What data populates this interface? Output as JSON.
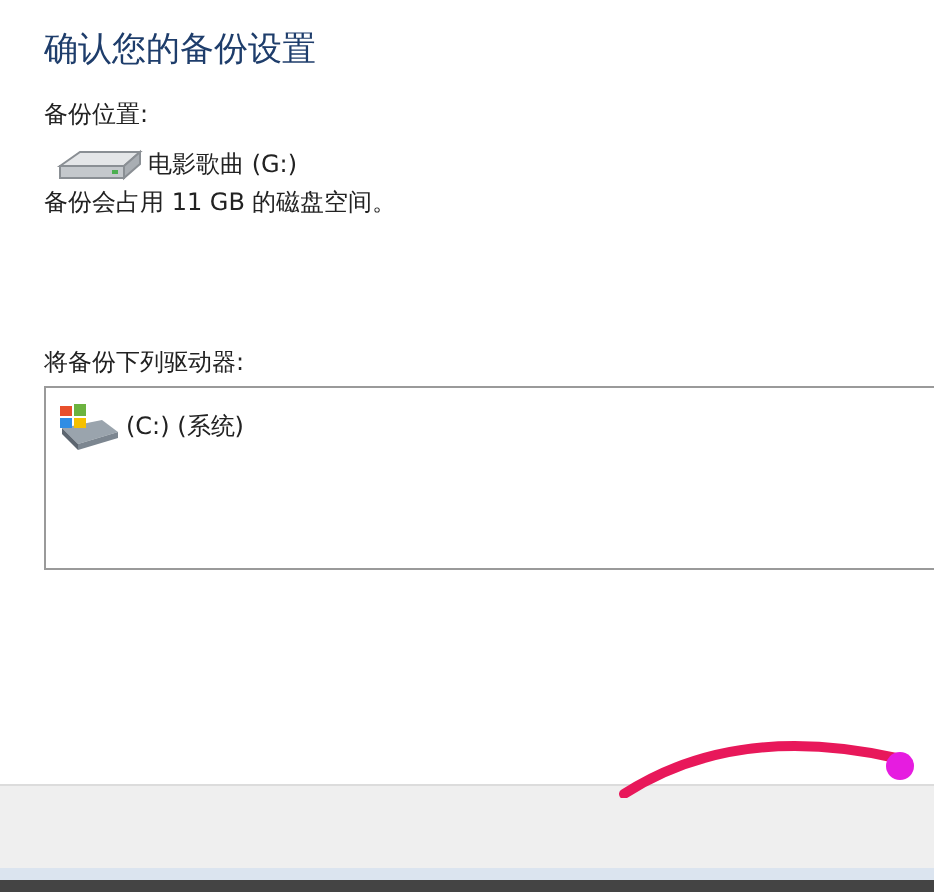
{
  "title": "确认您的备份设置",
  "location": {
    "label": "备份位置:",
    "drive": "电影歌曲 (G:)",
    "usage": "备份会占用 11 GB 的磁盘空间。"
  },
  "drives": {
    "label": "将备份下列驱动器:",
    "items": [
      {
        "name": "(C:) (系统)",
        "kind": "system"
      }
    ]
  }
}
